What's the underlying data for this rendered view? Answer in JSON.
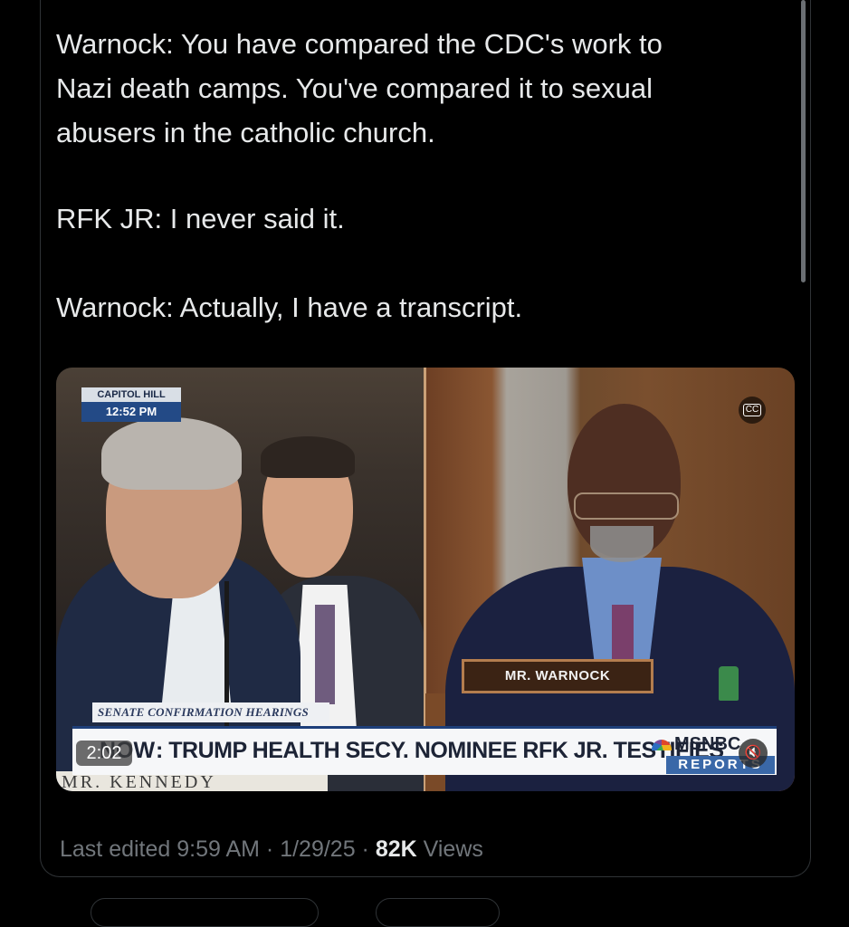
{
  "post": {
    "line1": "Warnock: You have compared the CDC's work to",
    "line2": "Nazi death camps. You've compared it to sexual",
    "line3": "abusers in the catholic church.",
    "para2": "RFK JR: I never said it.",
    "para3": "Warnock: Actually, I have a transcript."
  },
  "video": {
    "location": "CAPITOL HILL",
    "clock": "12:52 PM",
    "cc_label": "CC",
    "nameplate": "MR. WARNOCK",
    "senate_strip": "SENATE CONFIRMATION HEARINGS",
    "ticker_now": "NOW",
    "ticker_text": ": TRUMP HEALTH SECY. NOMINEE RFK JR. TESTIFIES",
    "network": "MSNBC",
    "network_sub": "REPORTS",
    "kennedy_strip": "MR. KENNEDY",
    "time": "2:02",
    "mute_icon": "🔇"
  },
  "meta": {
    "edited": "Last edited 9:59 AM · 1/29/25 · ",
    "views_count": "82K",
    "views_label": " Views"
  }
}
